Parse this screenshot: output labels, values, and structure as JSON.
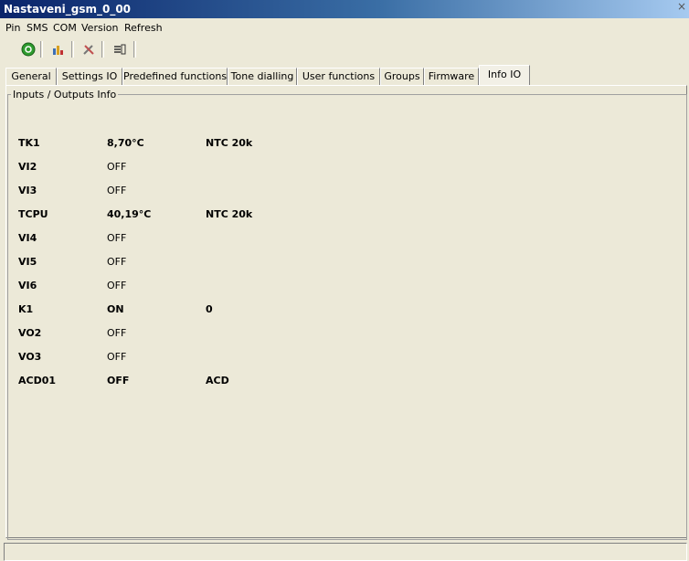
{
  "window": {
    "title": "Nastaveni_gsm_0_00",
    "close_glyph": "×"
  },
  "menu": [
    "Pin",
    "SMS",
    "COM",
    "Version",
    "Refresh"
  ],
  "toolbar": {
    "icons": [
      "connect-icon",
      "chart-icon",
      "tools-icon",
      "list-icon"
    ]
  },
  "tabs": [
    {
      "label": "General",
      "active": false
    },
    {
      "label": "Settings IO",
      "active": false
    },
    {
      "label": "Predefined functions",
      "active": false
    },
    {
      "label": "Tone dialling",
      "active": false
    },
    {
      "label": "User functions",
      "active": false
    },
    {
      "label": "Groups",
      "active": false
    },
    {
      "label": "Firmware",
      "active": false
    },
    {
      "label": "Info IO",
      "active": true
    }
  ],
  "groupbox": {
    "label": "Inputs / Outputs Info"
  },
  "io_rows": [
    {
      "name": "TK1",
      "value": "8,70°C",
      "extra": "NTC 20k",
      "value_bold": true
    },
    {
      "name": "VI2",
      "value": "OFF",
      "extra": "",
      "value_bold": false
    },
    {
      "name": "VI3",
      "value": "OFF",
      "extra": "",
      "value_bold": false
    },
    {
      "name": "TCPU",
      "value": "40,19°C",
      "extra": "NTC 20k",
      "value_bold": true
    },
    {
      "name": "VI4",
      "value": "OFF",
      "extra": "",
      "value_bold": false
    },
    {
      "name": "VI5",
      "value": "OFF",
      "extra": "",
      "value_bold": false
    },
    {
      "name": "VI6",
      "value": "OFF",
      "extra": "",
      "value_bold": false
    },
    {
      "name": "K1",
      "value": "ON",
      "extra": "0",
      "value_bold": true
    },
    {
      "name": "VO2",
      "value": "OFF",
      "extra": "",
      "value_bold": false
    },
    {
      "name": "VO3",
      "value": "OFF",
      "extra": "",
      "value_bold": false
    },
    {
      "name": "ACD01",
      "value": "OFF",
      "extra": "ACD",
      "value_bold": true
    }
  ]
}
